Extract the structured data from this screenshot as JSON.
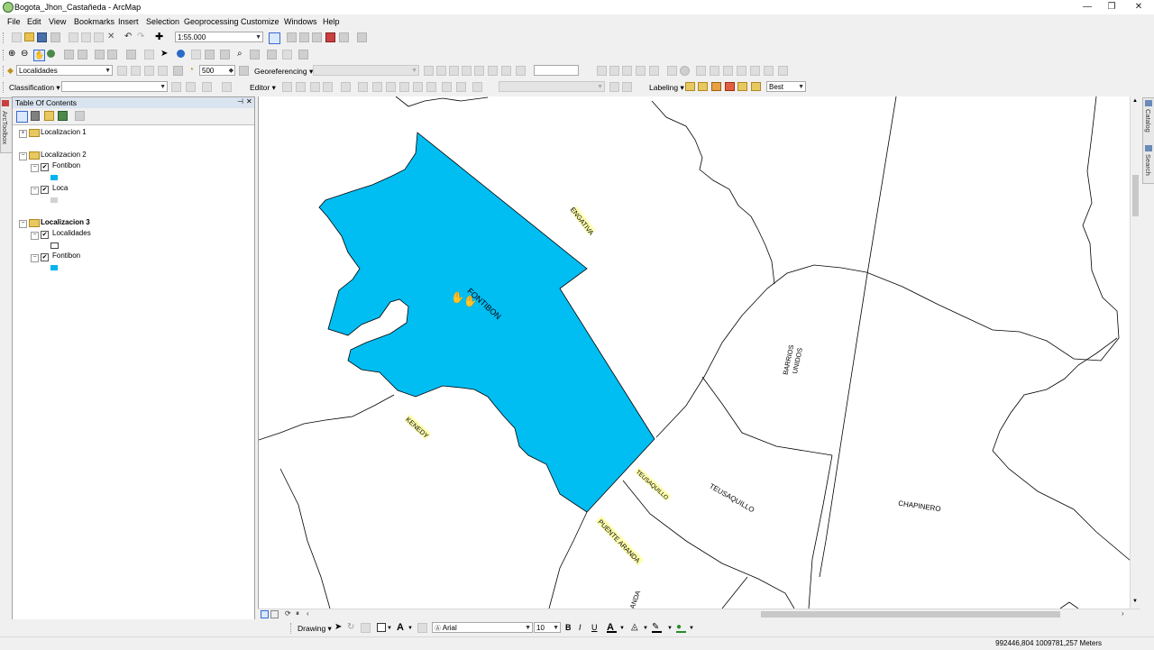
{
  "window": {
    "title": "Bogota_Jhon_Castañeda - ArcMap",
    "minimize": "—",
    "maximize": "❐",
    "close": "✕"
  },
  "menu": [
    "File",
    "Edit",
    "View",
    "Bookmarks",
    "Insert",
    "Selection",
    "Geoprocessing",
    "Customize",
    "Windows",
    "Help"
  ],
  "toolbar": {
    "scale": "1:55.000",
    "layer_selected": "Localidades",
    "opacity_value": "500",
    "georeferencing_label": "Georeferencing ▾",
    "classification_label": "Classification ▾",
    "editor_label": "Editor ▾",
    "labeling_label": "Labeling ▾",
    "label_placement": "Best"
  },
  "toc": {
    "title": "Table Of Contents",
    "pin": "⊣",
    "close": "✕",
    "groups": [
      {
        "name": "Localizacion 1",
        "expanded": false,
        "layers": []
      },
      {
        "name": "Localizacion 2",
        "expanded": true,
        "layers": [
          {
            "name": "Fontibon",
            "checked": true,
            "color": "#00b4f0"
          },
          {
            "name": "Loca",
            "checked": true,
            "color": "#d2d2d2"
          }
        ]
      },
      {
        "name": "Localizacion 3",
        "expanded": true,
        "bold": true,
        "layers": [
          {
            "name": "Localidades",
            "checked": true,
            "color": "#ffffff"
          },
          {
            "name": "Fontibon",
            "checked": true,
            "color": "#00b4f0"
          }
        ]
      }
    ]
  },
  "side_tabs": {
    "left": "ArcToolbox",
    "right1": "Catalog",
    "right2": "Search"
  },
  "map": {
    "fill_color": "#00bdf2",
    "labels": [
      {
        "text": "ENGATIVA",
        "highlight": true
      },
      {
        "text": "FONTIBON",
        "highlight": false
      },
      {
        "text": "KENEDY",
        "highlight": true
      },
      {
        "text": "TEUSAQUILLO",
        "highlight": true
      },
      {
        "text": "TEUSAQUILLO",
        "highlight": false
      },
      {
        "text": "PUENTE ARANDA",
        "highlight": true
      },
      {
        "text": "ANDA",
        "highlight": false
      },
      {
        "text": "BARRIOS",
        "highlight": false
      },
      {
        "text": "UNIDOS",
        "highlight": false
      },
      {
        "text": "CHAPINERO",
        "highlight": false
      }
    ]
  },
  "drawing": {
    "label": "Drawing ▾",
    "font": "Arial",
    "size": "10",
    "bold": "B",
    "italic": "I",
    "underline": "U"
  },
  "status": {
    "coordinates": "992446,804  1009781,257 Meters"
  }
}
